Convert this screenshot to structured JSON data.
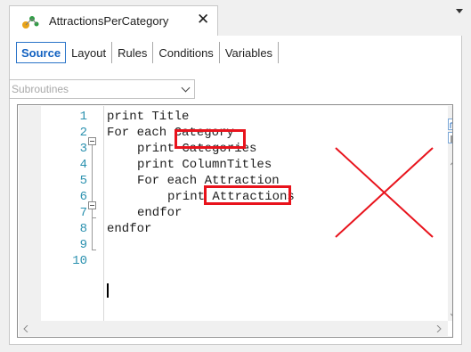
{
  "document_tab": {
    "title": "AttractionsPerCategory",
    "close_glyph": "✕",
    "icon": "gx-object-icon"
  },
  "subtabs": [
    "Source",
    "Layout",
    "Rules",
    "Conditions",
    "Variables"
  ],
  "active_subtab": "Source",
  "subroutines_select": {
    "placeholder": "Subroutines"
  },
  "editor": {
    "lines": [
      {
        "num": "1",
        "indent": 0,
        "text": "print Title"
      },
      {
        "num": "2",
        "indent": 0,
        "text": "For each Category"
      },
      {
        "num": "3",
        "indent": 1,
        "text": "print Categories"
      },
      {
        "num": "4",
        "indent": 1,
        "text": "print ColumnTitles"
      },
      {
        "num": "5",
        "indent": 1,
        "text": "For each Attraction"
      },
      {
        "num": "6",
        "indent": 2,
        "text": "print Attractions"
      },
      {
        "num": "7",
        "indent": 1,
        "text": "endfor"
      },
      {
        "num": "8",
        "indent": 0,
        "text": "endfor"
      },
      {
        "num": "9",
        "indent": 0,
        "text": ""
      },
      {
        "num": "10",
        "indent": 0,
        "text": ""
      }
    ],
    "highlighted_words": [
      "Category",
      "Attraction"
    ],
    "line_number_color": "#2b91af"
  },
  "scrollbar": {
    "left_arrow": "<",
    "right_arrow": ">",
    "up_arrow": "^",
    "down_arrow": "v"
  },
  "annotation_color": "#e8131c"
}
